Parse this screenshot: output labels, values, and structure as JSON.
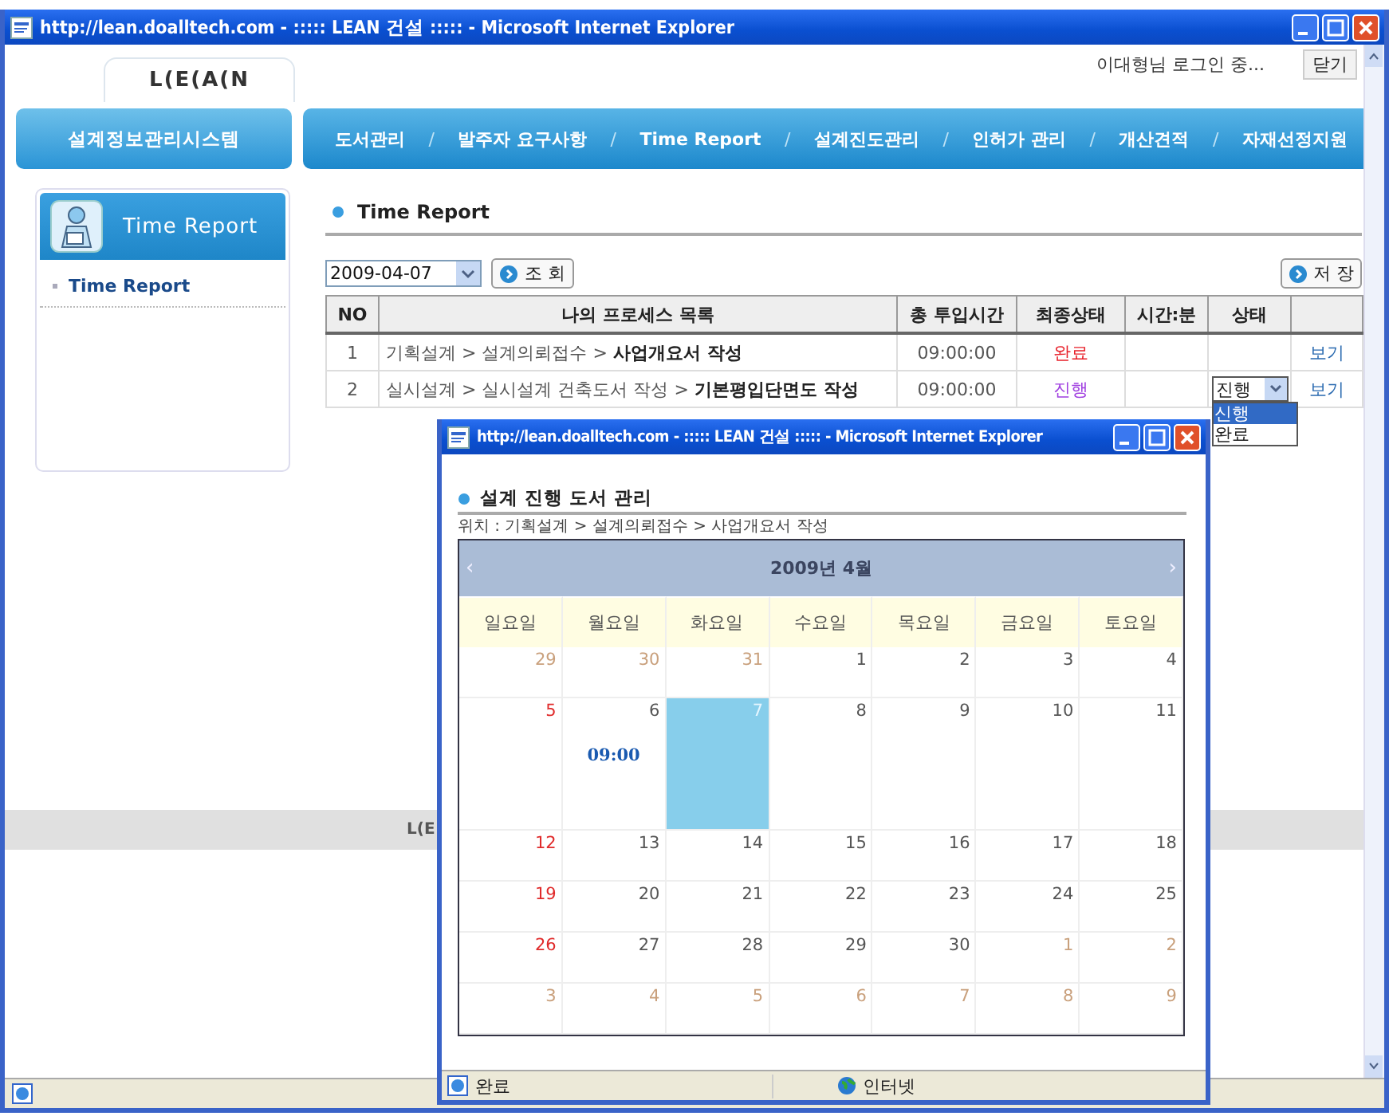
{
  "window": {
    "title": "http://lean.doalltech.com - ::::: LEAN 건설 ::::: - Microsoft Internet Explorer"
  },
  "header": {
    "logo": "L(E(A(N",
    "login_text": "이대형님 로그인 중...",
    "close_button": "닫기"
  },
  "nav": {
    "system_title": "설계정보관리시스템",
    "separator": "/",
    "items": [
      "도서관리",
      "발주자 요구사항",
      "Time Report",
      "설계진도관리",
      "인허가 관리",
      "개산견적",
      "자재선정지원"
    ]
  },
  "sidebar": {
    "title": "Time Report",
    "items": [
      "Time Report"
    ]
  },
  "main": {
    "title": "Time Report",
    "date": "2009-04-07",
    "search_button": "조 회",
    "save_button": "저 장"
  },
  "table": {
    "columns": [
      "NO",
      "나의 프로세스 목록",
      "총 투입시간",
      "최종상태",
      "시간:분",
      "상태",
      ""
    ],
    "rows": [
      {
        "no": "1",
        "process": "기획설계 > 설계의뢰접수 > **사업개요서 작성**",
        "total_time": "09:00:00",
        "final_status": "완료",
        "color": "#e8202a",
        "action": "보기"
      },
      {
        "no": "2",
        "process": "실시설계 > 실시설계 건축도서 작성 > **기본평입단면도 작성**",
        "total_time": "09:00:00",
        "final_status": "진행",
        "color": "#a040e0",
        "state": {
          "value": "진행",
          "expanded": true,
          "options": [
            {
              "label": "신행",
              "selected": true
            },
            {
              "label": "완료",
              "selected": false
            }
          ]
        },
        "action": "보기"
      }
    ]
  },
  "footer": {
    "logo": "L(E"
  },
  "popup": {
    "title": "http://lean.doalltech.com - ::::: LEAN 건설 ::::: - Microsoft Internet Explorer",
    "heading": "설계 진행 도서 관리",
    "location": "위치 : 기획설계 > 설계의뢰접수 > 사업개요서 작성",
    "calendar": {
      "month": "2009년 4월",
      "prev": "‹",
      "next": "›",
      "weekdays": [
        "일요일",
        "월요일",
        "화요일",
        "수요일",
        "목요일",
        "금요일",
        "토요일"
      ],
      "days": [
        {
          "day": "29",
          "kind": "other",
          "selected": false
        },
        {
          "day": "30",
          "kind": "other",
          "selected": false
        },
        {
          "day": "31",
          "kind": "other",
          "selected": false
        },
        {
          "day": "1",
          "kind": "weekday",
          "selected": false
        },
        {
          "day": "2",
          "kind": "weekday",
          "selected": false
        },
        {
          "day": "3",
          "kind": "weekday",
          "selected": false
        },
        {
          "day": "4",
          "kind": "weekday",
          "selected": false
        },
        {
          "day": "5",
          "kind": "sunday",
          "selected": false
        },
        {
          "day": "6",
          "kind": "weekday",
          "selected": false,
          "event": "09:00"
        },
        {
          "day": "7",
          "kind": "weekday",
          "selected": true
        },
        {
          "day": "8",
          "kind": "weekday",
          "selected": false
        },
        {
          "day": "9",
          "kind": "weekday",
          "selected": false
        },
        {
          "day": "10",
          "kind": "weekday",
          "selected": false
        },
        {
          "day": "11",
          "kind": "weekday",
          "selected": false
        },
        {
          "day": "12",
          "kind": "sunday",
          "selected": false
        },
        {
          "day": "13",
          "kind": "weekday",
          "selected": false
        },
        {
          "day": "14",
          "kind": "weekday",
          "selected": false
        },
        {
          "day": "15",
          "kind": "weekday",
          "selected": false
        },
        {
          "day": "16",
          "kind": "weekday",
          "selected": false
        },
        {
          "day": "17",
          "kind": "weekday",
          "selected": false
        },
        {
          "day": "18",
          "kind": "weekday",
          "selected": false
        },
        {
          "day": "19",
          "kind": "sunday",
          "selected": false
        },
        {
          "day": "20",
          "kind": "weekday",
          "selected": false
        },
        {
          "day": "21",
          "kind": "weekday",
          "selected": false
        },
        {
          "day": "22",
          "kind": "weekday",
          "selected": false
        },
        {
          "day": "23",
          "kind": "weekday",
          "selected": false
        },
        {
          "day": "24",
          "kind": "weekday",
          "selected": false
        },
        {
          "day": "25",
          "kind": "weekday",
          "selected": false
        },
        {
          "day": "26",
          "kind": "sunday",
          "selected": false
        },
        {
          "day": "27",
          "kind": "weekday",
          "selected": false
        },
        {
          "day": "28",
          "kind": "weekday",
          "selected": false
        },
        {
          "day": "29",
          "kind": "weekday",
          "selected": false
        },
        {
          "day": "30",
          "kind": "weekday",
          "selected": false
        },
        {
          "day": "1",
          "kind": "other",
          "selected": false
        },
        {
          "day": "2",
          "kind": "other",
          "selected": false
        },
        {
          "day": "3",
          "kind": "other",
          "selected": false
        },
        {
          "day": "4",
          "kind": "other",
          "selected": false
        },
        {
          "day": "5",
          "kind": "other",
          "selected": false
        },
        {
          "day": "6",
          "kind": "other",
          "selected": false
        },
        {
          "day": "7",
          "kind": "other",
          "selected": false
        },
        {
          "day": "8",
          "kind": "other",
          "selected": false
        },
        {
          "day": "9",
          "kind": "other",
          "selected": false
        }
      ]
    },
    "status": {
      "left": "완료",
      "zone": "인터넷"
    }
  }
}
